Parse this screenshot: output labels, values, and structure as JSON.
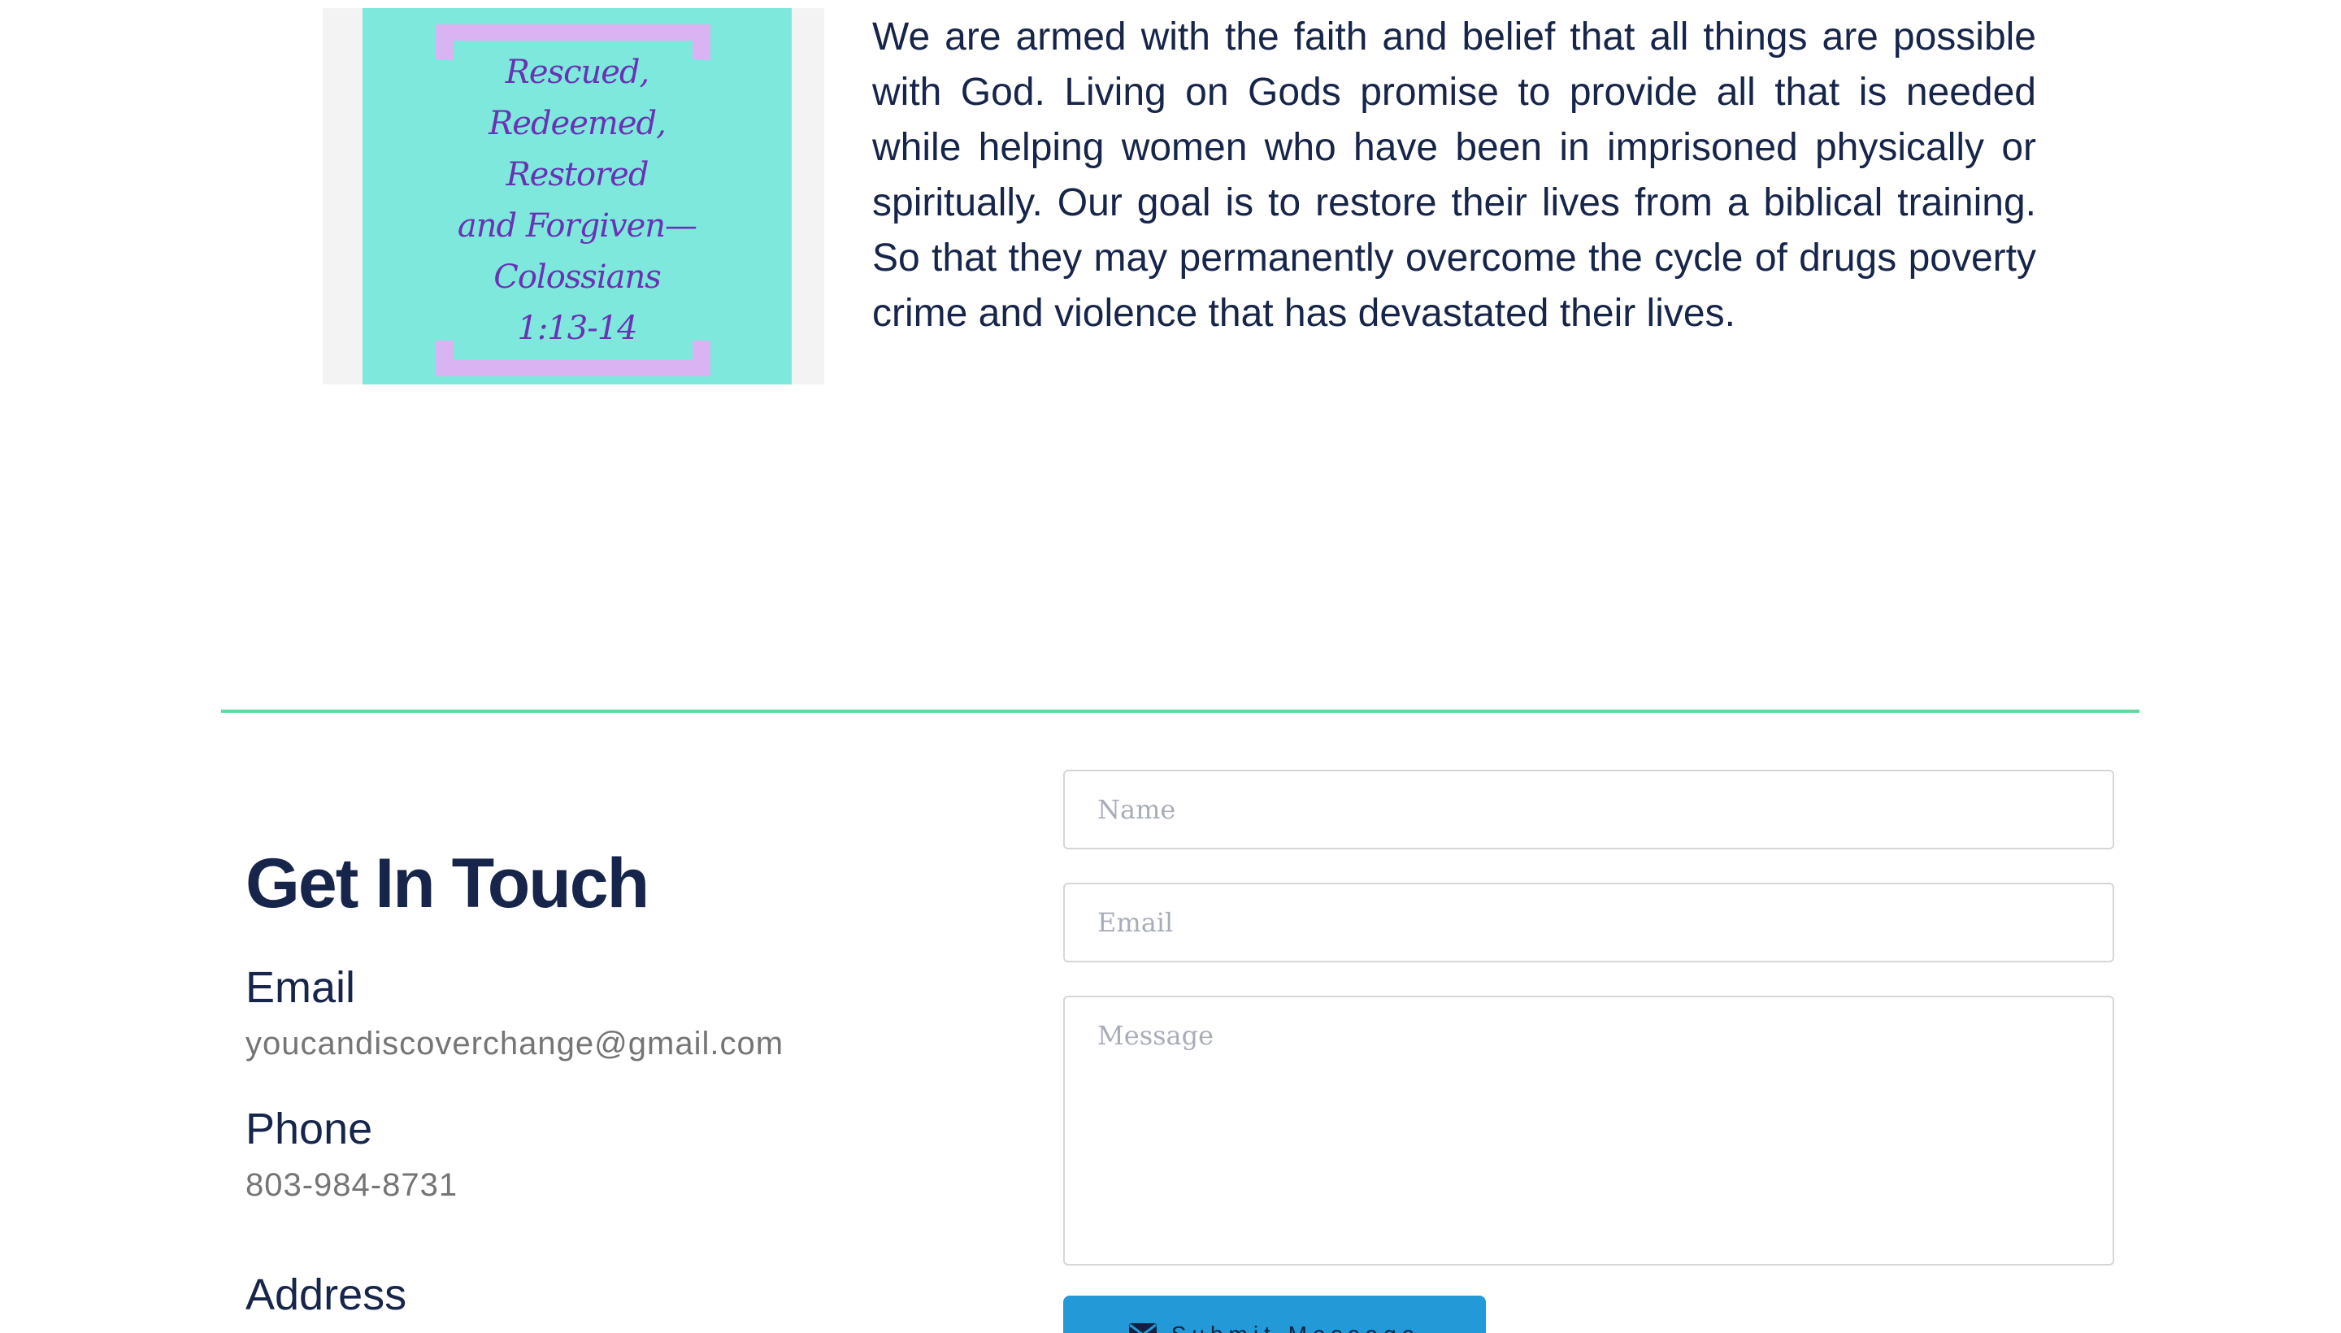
{
  "about": {
    "card_verse": "Rescued,\nRedeemed,\nRestored\nand Forgiven—\nColossians\n1:13-14",
    "paragraph": "We are armed with the faith and belief that all things are possible with God.  Living on  Gods promise to provide all that is needed while helping women who have been in imprisoned physically or spiritually. Our goal is to restore their lives from a biblical training. So that they may permanently  overcome the cycle of drugs poverty crime and violence that has devastated their lives."
  },
  "contact": {
    "heading": "Get In Touch",
    "email_label": "Email",
    "email_value": "youcandiscoverchange@gmail.com",
    "phone_label": "Phone",
    "phone_value": "803-984-8731",
    "address_label": "Address"
  },
  "form": {
    "name_placeholder": "Name",
    "email_placeholder": "Email",
    "message_placeholder": "Message",
    "submit_label": "Submit Message",
    "submit_icon": "envelope-icon"
  },
  "colors": {
    "text_primary": "#17254a",
    "text_muted": "#757575",
    "divider": "#5fd9a0",
    "button": "#2399d8",
    "card_background": "#7ee8dc",
    "card_text": "#6a32b4",
    "card_bracket": "#d9b3f2"
  }
}
